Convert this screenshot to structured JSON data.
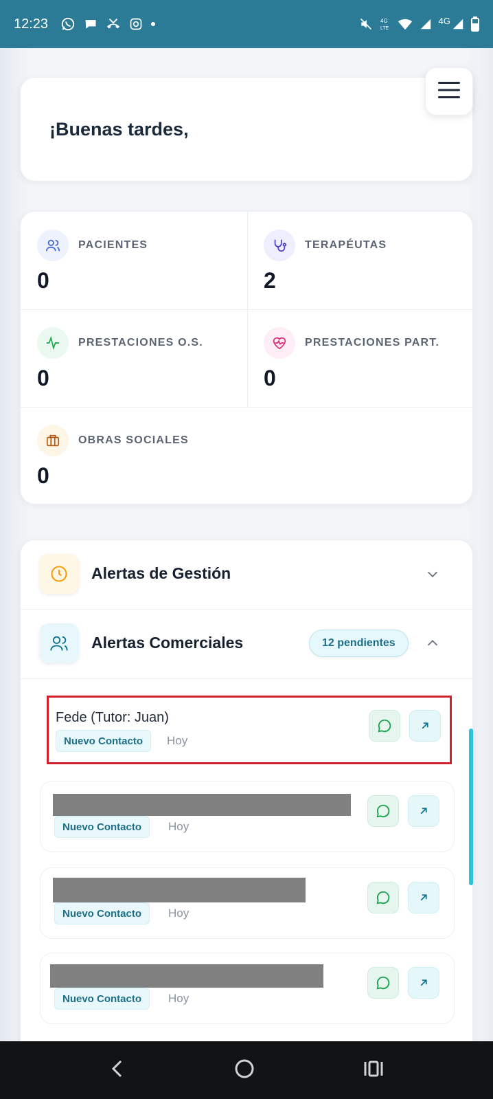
{
  "status_bar": {
    "time": "12:23",
    "network": "4G"
  },
  "header": {
    "greeting": "¡Buenas tardes,",
    "menu_icon": "hamburger-icon"
  },
  "stats": [
    {
      "label": "PACIENTES",
      "value": "0",
      "icon": "users-icon",
      "color": "#3b5bdb",
      "bg": "#eef2fd"
    },
    {
      "label": "TERAPÉUTAS",
      "value": "2",
      "icon": "stethoscope-icon",
      "color": "#4338ca",
      "bg": "#efeefc"
    },
    {
      "label": "PRESTACIONES O.S.",
      "value": "0",
      "icon": "activity-icon",
      "color": "#16a34a",
      "bg": "#eaf8ef"
    },
    {
      "label": "PRESTACIONES PART.",
      "value": "0",
      "icon": "heart-pulse-icon",
      "color": "#db2777",
      "bg": "#fdeef5"
    },
    {
      "label": "OBRAS SOCIALES",
      "value": "0",
      "icon": "briefcase-icon",
      "color": "#b45309",
      "bg": "#fdf5e6"
    }
  ],
  "alerts": {
    "gestion": {
      "title": "Alertas de Gestión",
      "icon": "clock-icon"
    },
    "comerciales": {
      "title": "Alertas Comerciales",
      "icon": "users-icon",
      "badge": "12 pendientes"
    },
    "items": [
      {
        "name": "Fede (Tutor: Juan)",
        "tag": "Nuevo Contacto",
        "time": "Hoy"
      },
      {
        "name": "",
        "tag": "Nuevo Contacto",
        "time": "Hoy"
      },
      {
        "name": "",
        "tag": "Nuevo Contacto",
        "time": "Hoy"
      },
      {
        "name": "",
        "tag": "Nuevo Contacto",
        "time": "Hoy"
      }
    ]
  }
}
